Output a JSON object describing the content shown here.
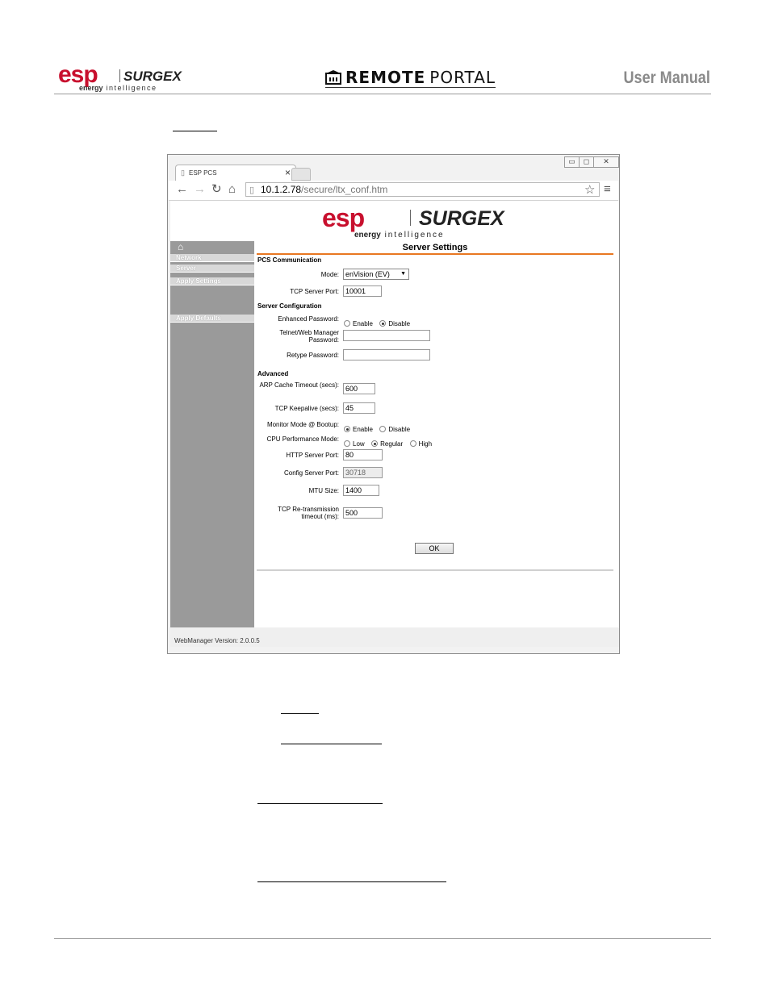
{
  "header": {
    "esp_logo": "esp",
    "surgex_logo": "SURGEX",
    "tagline_bold": "energy",
    "tagline_rest": "intelligence",
    "portal_word1": "REMOTE",
    "portal_word2": "PORTAL",
    "manual_title": "User Manual"
  },
  "browser": {
    "tab_title": "ESP PCS",
    "tab_close": "×",
    "url_host": "10.1.2.78",
    "url_path": "/secure/ltx_conf.htm",
    "star_icon": "☆",
    "menu_icon": "≡",
    "window_buttons": [
      "▭",
      "◻",
      "✕"
    ]
  },
  "page": {
    "title": "Server Settings",
    "sidebar": {
      "home_icon": "⌂",
      "items": [
        "Network",
        "Server",
        "Apply Settings",
        "Apply Defaults"
      ]
    },
    "sections": {
      "pcs": "PCS Communication",
      "server_config": "Server Configuration",
      "advanced": "Advanced"
    },
    "labels": {
      "mode": "Mode:",
      "tcp_server_port": "TCP Server Port:",
      "enhanced_password": "Enhanced Password:",
      "telnet_password": "Telnet/Web Manager Password:",
      "retype_password": "Retype Password:",
      "arp_cache": "ARP Cache Timeout (secs):",
      "tcp_keepalive": "TCP Keepalive (secs):",
      "monitor_mode": "Monitor Mode @ Bootup:",
      "cpu_mode": "CPU Performance Mode:",
      "http_port": "HTTP Server Port:",
      "config_port": "Config Server Port:",
      "mtu_size": "MTU Size:",
      "tcp_retrans": "TCP Re-transmission timeout (ms):"
    },
    "values": {
      "mode": "enVision (EV)",
      "tcp_server_port": "10001",
      "arp_cache": "600",
      "tcp_keepalive": "45",
      "http_port": "80",
      "config_port": "30718",
      "mtu_size": "1400",
      "tcp_retrans": "500"
    },
    "options": {
      "enable": "Enable",
      "disable": "Disable",
      "low": "Low",
      "regular": "Regular",
      "high": "High"
    },
    "ok_button": "OK",
    "footer": "WebManager Version: 2.0.0.5"
  }
}
